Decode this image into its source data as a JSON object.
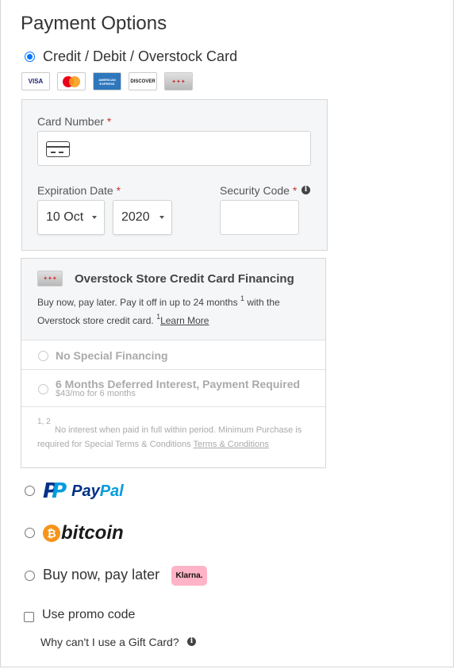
{
  "title": "Payment Options",
  "card_option": {
    "label": "Credit / Debit / Overstock Card",
    "selected": true
  },
  "card_logos": {
    "visa": "VISA",
    "mastercard": "MasterCard",
    "amex": "AMERICAN EXPRESS",
    "discover": "DISCOVER",
    "overstock": "✦✦✦"
  },
  "card_form": {
    "card_number_label": "Card Number",
    "required_mark": "*",
    "expiration_label": "Expiration Date",
    "security_label": "Security Code",
    "month_value": "10 Oct",
    "year_value": "2020",
    "info_glyph": "i"
  },
  "financing": {
    "title": "Overstock Store Credit Card Financing",
    "desc_part1": "Buy now, pay later. Pay it off in up to 24 months",
    "sup1": "1",
    "desc_part2": "with the",
    "desc_part3": "Overstock store credit card.",
    "sup2": "1",
    "learn_more": "Learn More",
    "options": [
      {
        "label": "No Special Financing"
      },
      {
        "label": "6 Months Deferred Interest, Payment Required",
        "sub": "$43/mo for 6 months"
      }
    ],
    "footnote_sup": "1, 2",
    "footnote_line1": "No interest when paid in full within period. Minimum Purchase is",
    "footnote_line2": "required for Special Terms & Conditions",
    "terms_link": "Terms & Conditions"
  },
  "paypal": {
    "pay": "Pay",
    "pal": "Pal"
  },
  "bitcoin": {
    "symbol": "₿",
    "text": "bitcoin"
  },
  "bnpl": {
    "label": "Buy now, pay later",
    "badge": "Klarna."
  },
  "promo": {
    "label": "Use promo code"
  },
  "gift_card": {
    "text": "Why can't I use a Gift Card?"
  },
  "colors": {
    "accent": "#0075ff",
    "required": "#cc3333",
    "paypal_dark": "#003087",
    "paypal_light": "#009cde",
    "bitcoin": "#f7931a",
    "klarna": "#ffb3c7"
  }
}
